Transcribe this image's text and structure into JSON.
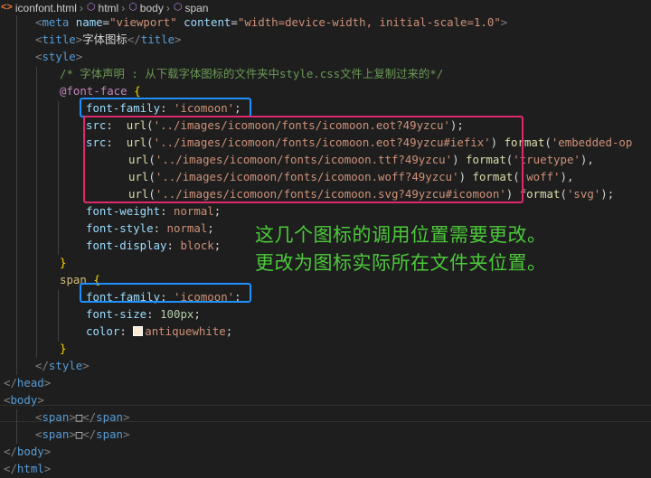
{
  "breadcrumb": [
    {
      "label": "iconfont.html",
      "icon": "html-file-icon"
    },
    {
      "label": "html",
      "icon": "element-cube-icon"
    },
    {
      "label": "body",
      "icon": "element-cube-icon"
    },
    {
      "label": "span",
      "icon": "element-cube-icon"
    }
  ],
  "code": {
    "l0": {
      "open": "<",
      "tag": "meta",
      "a1": "name",
      "eq": "=",
      "v1": "\"viewport\"",
      "a2": "content",
      "v2": "\"width=device-width, initial-scale=1.0\"",
      "close": ">"
    },
    "l1": {
      "open1": "<",
      "tag": "title",
      "close1": ">",
      "text": "字体图标",
      "open2": "</",
      "close2": ">"
    },
    "l2": {
      "open": "<",
      "tag": "style",
      "close": ">"
    },
    "l3": {
      "comment": "/* 字体声明 : 从下载字体图标的文件夹中style.css文件上复制过来的*/"
    },
    "l4": {
      "atrule": "@font-face",
      "brace": "{"
    },
    "l5": {
      "prop": "font-family",
      "colon": ": ",
      "val": "'icomoon'",
      "semi": ";"
    },
    "l6": {
      "prop": "src",
      "colon": ":  ",
      "fn": "url",
      "paren1": "(",
      "str": "'../images/icomoon/fonts/icomoon.eot?49yzcu'",
      "paren2": ");"
    },
    "l7": {
      "prop": "src",
      "colon": ":  ",
      "fn": "url",
      "paren1": "(",
      "str": "'../images/icomoon/fonts/icomoon.eot?49yzcu#iefix'",
      "paren2": ")",
      "fn2": "format",
      "paren3": "(",
      "str2": "'embedded-op"
    },
    "l8": {
      "fn": "url",
      "paren1": "(",
      "str": "'../images/icomoon/fonts/icomoon.ttf?49yzcu'",
      "paren2": ")",
      "fn2": "format",
      "paren3": "(",
      "str2": "'truetype'",
      "paren4": "),"
    },
    "l9": {
      "fn": "url",
      "paren1": "(",
      "str": "'../images/icomoon/fonts/icomoon.woff?49yzcu'",
      "paren2": ")",
      "fn2": "format",
      "paren3": "(",
      "str2": "'woff'",
      "paren4": "),"
    },
    "l10": {
      "fn": "url",
      "paren1": "(",
      "str": "'../images/icomoon/fonts/icomoon.svg?49yzcu#icomoon'",
      "paren2": ")",
      "fn2": "format",
      "paren3": "(",
      "str2": "'svg'",
      "paren4": ");"
    },
    "l11": {
      "prop": "font-weight",
      "colon": ": ",
      "val": "normal",
      "semi": ";"
    },
    "l12": {
      "prop": "font-style",
      "colon": ": ",
      "val": "normal",
      "semi": ";"
    },
    "l13": {
      "prop": "font-display",
      "colon": ": ",
      "val": "block",
      "semi": ";"
    },
    "l14": {
      "brace": "}"
    },
    "l15": {
      "sel": "span",
      "brace": "{"
    },
    "l16": {
      "prop": "font-family",
      "colon": ": ",
      "val": "'icomoon'",
      "semi": ";"
    },
    "l17": {
      "prop": "font-size",
      "colon": ": ",
      "val": "100px",
      "semi": ";"
    },
    "l18": {
      "prop": "color",
      "colon": ": ",
      "val": "antiquewhite",
      "semi": ";"
    },
    "l19": {
      "brace": "}"
    },
    "l20": {
      "open": "</",
      "tag": "style",
      "close": ">"
    },
    "l21": {
      "open": "</",
      "tag": "head",
      "close": ">"
    },
    "l22": {
      "open": "<",
      "tag": "body",
      "close": ">"
    },
    "l23": {
      "open1": "<",
      "tag": "span",
      "close1": ">",
      "glyph": "□",
      "open2": "</",
      "close2": ">"
    },
    "l24": {
      "open1": "<",
      "tag": "span",
      "close1": ">",
      "glyph": "□",
      "open2": "</",
      "close2": ">"
    },
    "l25": {
      "open": "</",
      "tag": "body",
      "close": ">"
    },
    "l26": {
      "open": "</",
      "tag": "html",
      "close": ">"
    }
  },
  "annotation": {
    "line1": "这几个图标的调用位置需要更改。",
    "line2": "更改为图标实际所在文件夹位置。"
  },
  "colors": {
    "background": "#1e1e1e",
    "highlight_blue": "#1e90ff",
    "highlight_pink": "#e0286e",
    "annotation_green": "#4cc93a",
    "swatch": "#faebd7"
  }
}
